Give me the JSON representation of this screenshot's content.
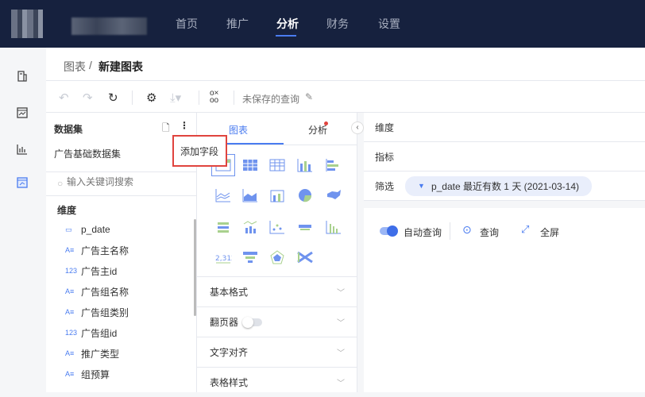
{
  "nav": {
    "items": [
      {
        "label": "首页"
      },
      {
        "label": "推广"
      },
      {
        "label": "分析",
        "active": true
      },
      {
        "label": "财务"
      },
      {
        "label": "设置"
      }
    ]
  },
  "breadcrumb": {
    "parent": "图表",
    "sep": "/",
    "current": "新建图表"
  },
  "toolbar": {
    "query_name": "未保存的查询"
  },
  "dataset": {
    "title": "数据集",
    "name": "广告基础数据集",
    "search_placeholder": "输入关键词搜索",
    "section": "维度",
    "fields": [
      {
        "type": "date",
        "label": "p_date"
      },
      {
        "type": "A≡",
        "label": "广告主名称"
      },
      {
        "type": "123",
        "label": "广告主id"
      },
      {
        "type": "A≡",
        "label": "广告组名称"
      },
      {
        "type": "A≡",
        "label": "广告组类别"
      },
      {
        "type": "123",
        "label": "广告组id"
      },
      {
        "type": "A≡",
        "label": "推广类型"
      },
      {
        "type": "A≡",
        "label": "组预算"
      }
    ]
  },
  "tooltip": "添加字段",
  "mid": {
    "tabs": [
      {
        "label": "图表"
      },
      {
        "label": "分析"
      }
    ],
    "accordions": [
      {
        "label": "基本格式"
      },
      {
        "label": "翻页器"
      },
      {
        "label": "文字对齐"
      },
      {
        "label": "表格样式"
      }
    ]
  },
  "right": {
    "dimension": "维度",
    "metric": "指标",
    "filter": "筛选",
    "filter_chip": "p_date 最近有数 1 天 (2021-03-14)",
    "auto_query": "自动查询",
    "query": "查询",
    "fullscreen": "全屏"
  },
  "colors": {
    "accent": "#4a7cf0",
    "nav_bg": "#16213e",
    "highlight": "#e0443e"
  }
}
